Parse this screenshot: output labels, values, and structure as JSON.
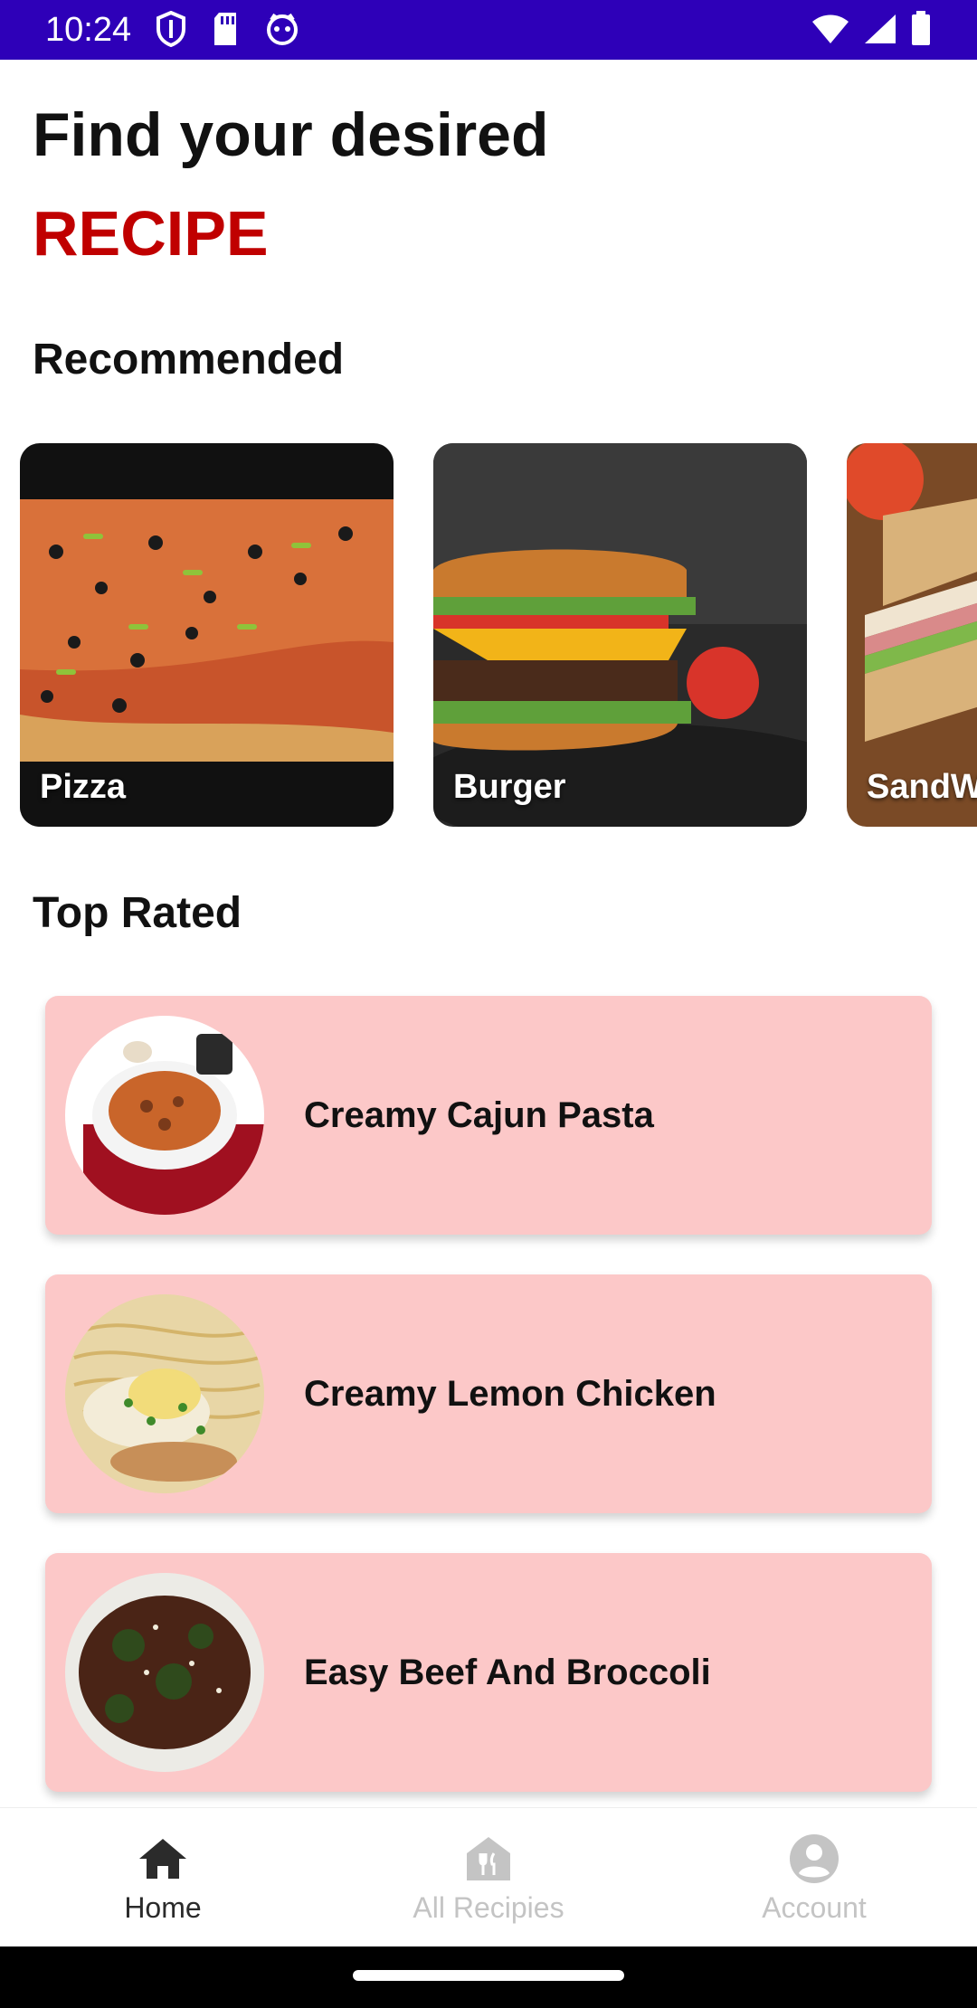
{
  "status_bar": {
    "time": "10:24",
    "icons_left": [
      "shield-icon",
      "sd-card-icon",
      "notification-icon"
    ],
    "icons_right": [
      "wifi-icon",
      "cell-signal-icon",
      "battery-icon"
    ],
    "background": "#2e00b8"
  },
  "header": {
    "title_line": "Find your desired",
    "title_accent": "RECIPE",
    "accent_color": "#c00000"
  },
  "recommended": {
    "title": "Recommended",
    "items": [
      {
        "label": "Pizza",
        "icon": "pizza-image"
      },
      {
        "label": "Burger",
        "icon": "burger-image"
      },
      {
        "label": "SandWich",
        "icon": "sandwich-image"
      }
    ]
  },
  "top_rated": {
    "title": "Top Rated",
    "card_color": "#fcc8c8",
    "items": [
      {
        "name": "Creamy Cajun Pasta",
        "icon": "pasta-image"
      },
      {
        "name": "Creamy Lemon Chicken",
        "icon": "chicken-image"
      },
      {
        "name": "Easy Beef And Broccoli",
        "icon": "beef-broccoli-image"
      }
    ]
  },
  "bottom_nav": {
    "items": [
      {
        "label": "Home",
        "icon": "home-icon",
        "active": true
      },
      {
        "label": "All Recipies",
        "icon": "recipes-icon",
        "active": false
      },
      {
        "label": "Account",
        "icon": "account-icon",
        "active": false
      }
    ]
  }
}
